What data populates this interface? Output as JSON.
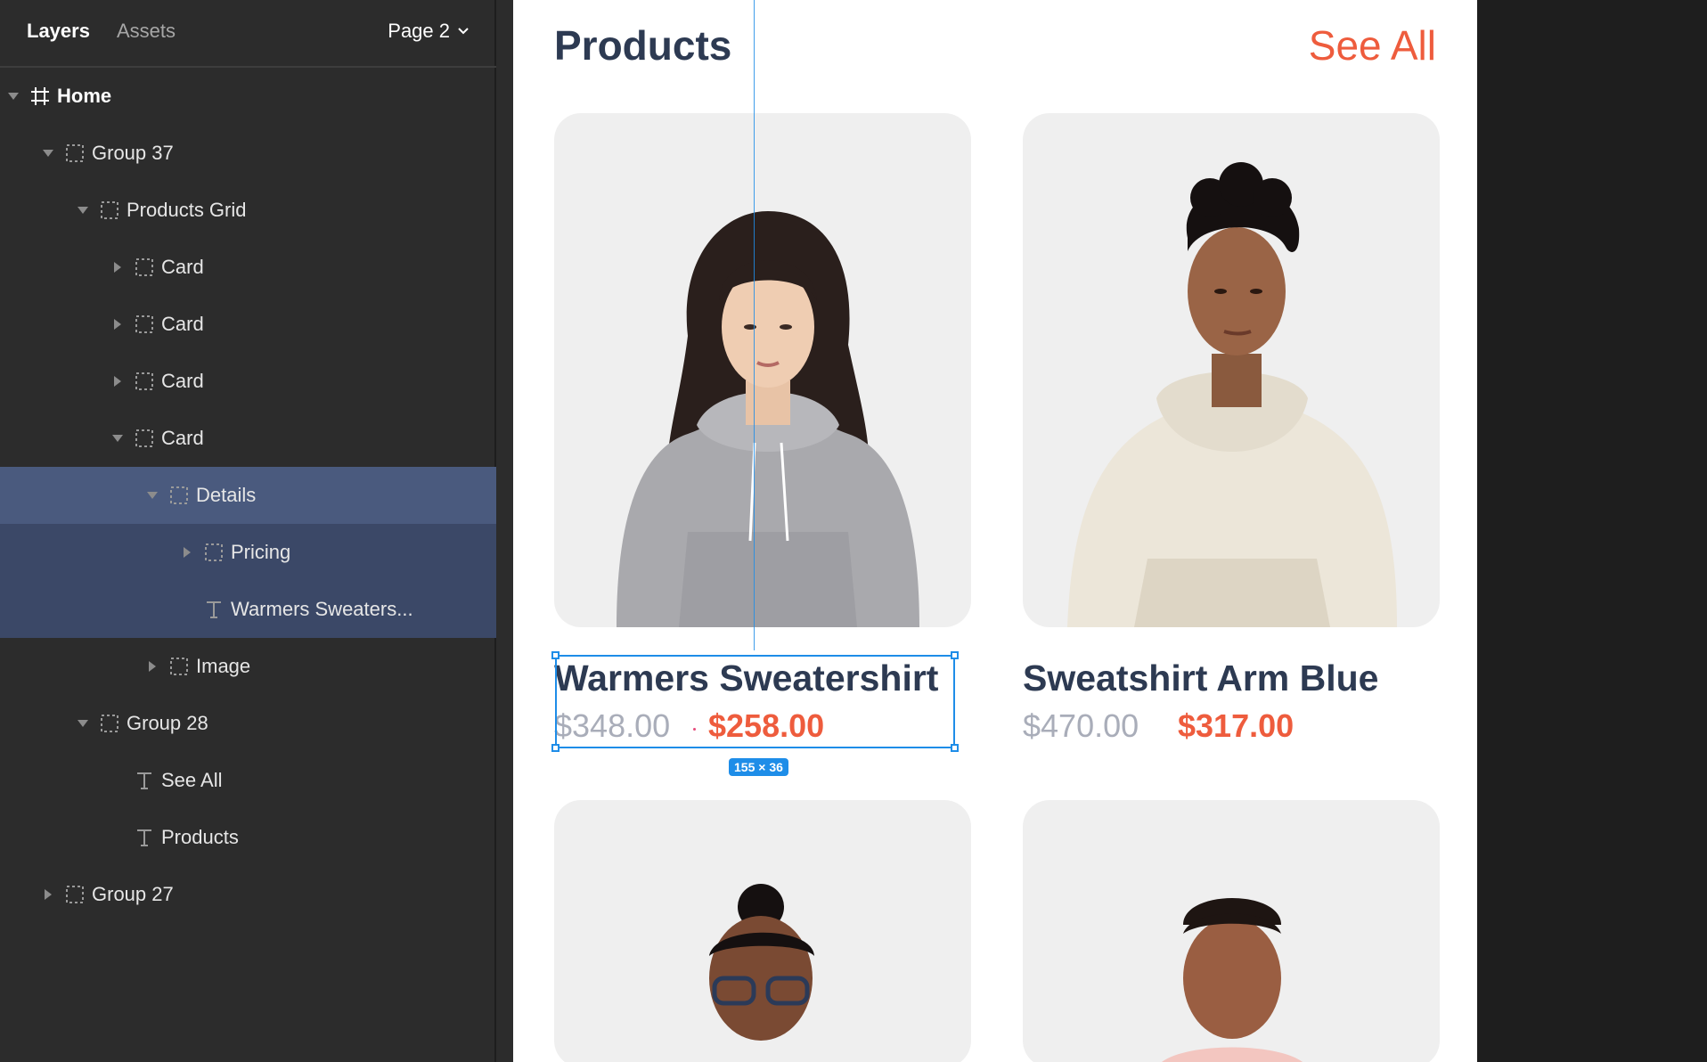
{
  "panel": {
    "tabs": {
      "layers": "Layers",
      "assets": "Assets"
    },
    "page_selector": "Page 2",
    "layers": [
      {
        "label": "Home",
        "depth": 0,
        "expanded": true,
        "kind": "frame"
      },
      {
        "label": "Group 37",
        "depth": 1,
        "expanded": true,
        "kind": "group"
      },
      {
        "label": "Products Grid",
        "depth": 2,
        "expanded": true,
        "kind": "group"
      },
      {
        "label": "Card",
        "depth": 3,
        "expanded": false,
        "kind": "group"
      },
      {
        "label": "Card",
        "depth": 3,
        "expanded": false,
        "kind": "group"
      },
      {
        "label": "Card",
        "depth": 3,
        "expanded": false,
        "kind": "group"
      },
      {
        "label": "Card",
        "depth": 3,
        "expanded": true,
        "kind": "group"
      },
      {
        "label": "Details",
        "depth": 4,
        "expanded": true,
        "kind": "group",
        "selected": "primary"
      },
      {
        "label": "Pricing",
        "depth": 5,
        "expanded": false,
        "kind": "group",
        "selected": "child"
      },
      {
        "label": "Warmers Sweaters...",
        "depth": 5,
        "expanded": null,
        "kind": "text",
        "selected": "child"
      },
      {
        "label": "Image",
        "depth": 4,
        "expanded": false,
        "kind": "group"
      },
      {
        "label": "Group 28",
        "depth": 2,
        "expanded": true,
        "kind": "group"
      },
      {
        "label": "See All",
        "depth": 3,
        "expanded": null,
        "kind": "text"
      },
      {
        "label": "Products",
        "depth": 3,
        "expanded": null,
        "kind": "text"
      },
      {
        "label": "Group 27",
        "depth": 1,
        "expanded": false,
        "kind": "group"
      }
    ]
  },
  "canvas": {
    "section_title": "Products",
    "see_all": "See All",
    "products": [
      {
        "title": "Warmers Sweatershirt",
        "old_price": "$348.00",
        "new_price": "$258.00",
        "image": "woman-grey-hoodie"
      },
      {
        "title": "Sweatshirt Arm Blue",
        "old_price": "$470.00",
        "new_price": "$317.00",
        "image": "man-cream-hoodie"
      }
    ],
    "next_row_images": [
      "woman-glasses",
      "woman-braids"
    ],
    "selection_size": "155 × 36"
  },
  "colors": {
    "accent": "#ee5c3d",
    "title": "#2d3a52",
    "muted_price": "#a9adb9",
    "selection": "#1e8de8",
    "panel_bg": "#2c2c2c",
    "layer_selected": "#4a5a7e",
    "layer_selected_child": "#3b4867"
  }
}
